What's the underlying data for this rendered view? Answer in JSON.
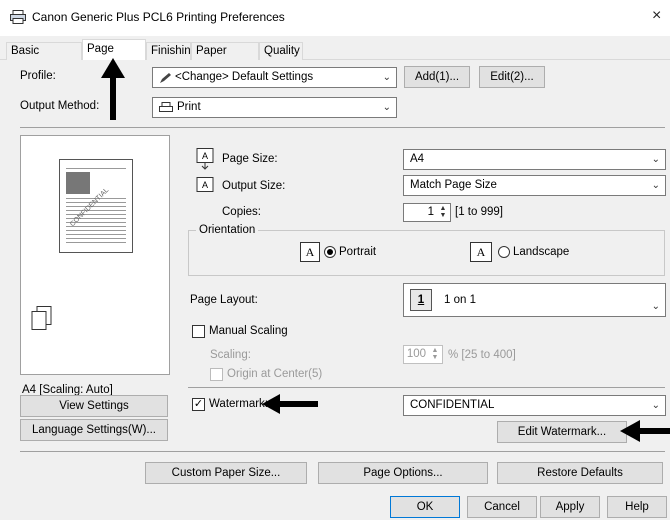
{
  "window": {
    "title": "Canon Generic Plus PCL6 Printing Preferences",
    "close_glyph": "×"
  },
  "tabs": [
    "Basic Settings",
    "Page Setup",
    "Finishing",
    "Paper Source",
    "Quality"
  ],
  "profile": {
    "label": "Profile:",
    "value": "<Change> Default Settings",
    "add_label": "Add(1)...",
    "edit_label": "Edit(2)..."
  },
  "output_method": {
    "label": "Output Method:",
    "value": "Print"
  },
  "page_size": {
    "label": "Page Size:",
    "value": "A4"
  },
  "output_size": {
    "label": "Output Size:",
    "value": "Match Page Size"
  },
  "copies": {
    "label": "Copies:",
    "value": "1",
    "range": "[1 to 999]"
  },
  "orientation": {
    "label": "Orientation",
    "portrait": "Portrait",
    "landscape": "Landscape",
    "selected": "Portrait",
    "icon_letter": "A"
  },
  "page_layout": {
    "label": "Page Layout:",
    "value": "1 on 1",
    "icon_number": "1"
  },
  "manual_scaling": {
    "label": "Manual Scaling",
    "checked": false
  },
  "scaling": {
    "label": "Scaling:",
    "value": "100",
    "range": "% [25 to 400]"
  },
  "origin_center": {
    "label": "Origin at Center(5)",
    "checked": false
  },
  "watermark": {
    "label": "Watermark:",
    "checked": true,
    "value": "CONFIDENTIAL",
    "edit_label": "Edit Watermark..."
  },
  "preview": {
    "caption": "A4 [Scaling: Auto]",
    "watermark_text": "CONFIDENTIAL"
  },
  "left_buttons": {
    "view_settings": "View Settings",
    "language_settings": "Language Settings(W)..."
  },
  "bottom_row": {
    "custom_paper": "Custom Paper Size...",
    "page_options": "Page Options...",
    "restore_defaults": "Restore Defaults"
  },
  "dialog_buttons": {
    "ok": "OK",
    "cancel": "Cancel",
    "apply": "Apply",
    "help": "Help"
  },
  "annotations": [
    "arrow-up-to-page-setup-tab",
    "arrow-left-to-watermark-checkbox",
    "arrow-left-to-edit-watermark-button"
  ]
}
